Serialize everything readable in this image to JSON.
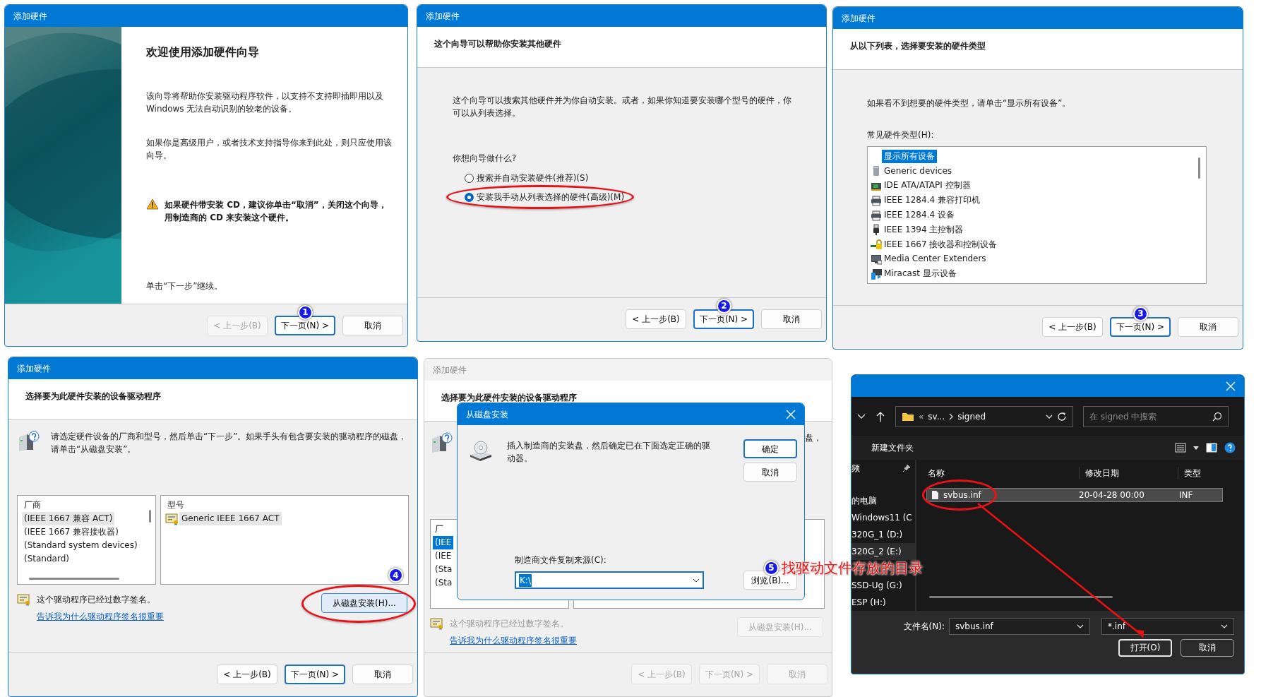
{
  "welcome_wizard": {
    "title": "添加硬件",
    "heading": "欢迎使用添加硬件向导",
    "paragraphs": [
      "该向导将帮助你安装驱动程序软件，以支持不支持即插即用以及 Windows 无法自动识别的较老的设备。",
      "如果你是高级用户，或者技术支持指导你来到此处，则只应使用该向导。"
    ],
    "warning": "如果硬件带安装 CD，建议你单击“取消”，关闭这个向导，用制造商的 CD 来安装这个硬件。",
    "footer_note": "单击“下一步”继续。",
    "buttons": [
      {
        "label": "< 上一步(B)",
        "disabled": true,
        "default": false
      },
      {
        "label": "下一页(N) >",
        "disabled": false,
        "default": true,
        "step_badge": "1"
      },
      {
        "label": "取消",
        "disabled": false,
        "default": false
      }
    ]
  },
  "task_wizard": {
    "title": "添加硬件",
    "heading": "这个向导可以帮助你安装其他硬件",
    "paragraph": "这个向导可以搜索其他硬件并为你自动安装。或者，如果你知道要安装哪个型号的硬件，你可以从列表选择。",
    "question": "你想向导做什么?",
    "options": [
      {
        "label": "搜索并自动安装硬件(推荐)(S)",
        "selected": false,
        "circled": false
      },
      {
        "label": "安装我手动从列表选择的硬件(高级)(M)",
        "selected": true,
        "circled": true
      }
    ],
    "buttons": [
      {
        "label": "< 上一步(B)",
        "disabled": false,
        "default": false
      },
      {
        "label": "下一页(N) >",
        "disabled": false,
        "default": true,
        "step_badge": "2"
      },
      {
        "label": "取消",
        "disabled": false,
        "default": false
      }
    ]
  },
  "hardware_type_wizard": {
    "title": "添加硬件",
    "heading": "从以下列表，选择要安装的硬件类型",
    "paragraph": "如果看不到想要的硬件类型，请单击“显示所有设备”。",
    "list_label": "常见硬件类型(H):",
    "items": [
      {
        "kind": "none",
        "label": "显示所有设备",
        "selected": true
      },
      {
        "kind": "tower",
        "label": "Generic devices",
        "selected": false
      },
      {
        "kind": "card",
        "label": "IDE ATA/ATAPI 控制器",
        "selected": false
      },
      {
        "kind": "printer",
        "label": "IEEE 1284.4 兼容打印机",
        "selected": false
      },
      {
        "kind": "printer",
        "label": "IEEE 1284.4 设备",
        "selected": false
      },
      {
        "kind": "plug",
        "label": "IEEE 1394 主控制器",
        "selected": false
      },
      {
        "kind": "lock",
        "label": "IEEE 1667 接收器和控制设备",
        "selected": false
      },
      {
        "kind": "monitor",
        "label": "Media Center Extenders",
        "selected": false
      },
      {
        "kind": "cast",
        "label": "Miracast 显示设备",
        "selected": false
      }
    ],
    "buttons": [
      {
        "label": "< 上一步(B)",
        "disabled": false,
        "default": false
      },
      {
        "label": "下一页(N) >",
        "disabled": false,
        "default": true,
        "step_badge": "3"
      },
      {
        "label": "取消",
        "disabled": false,
        "default": false
      }
    ]
  },
  "driver_wizard": {
    "title": "添加硬件",
    "heading": "选择要为此硬件安装的设备驱动程序",
    "description": "请选定硬件设备的厂商和型号，然后单击“下一步”。如果手头有包含要安装的驱动程序的磁盘，请单击“从磁盘安装”。",
    "lists_focused": false,
    "manufacturer_header": "厂商",
    "manufacturers": [
      {
        "label": "(IEEE 1667 兼容 ACT)",
        "selected": true
      },
      {
        "label": "(IEEE 1667 兼容接收器)",
        "selected": false
      },
      {
        "label": "(Standard system devices)",
        "selected": false
      },
      {
        "label": "(Standard)",
        "selected": false
      }
    ],
    "model_header": "型号",
    "models": [
      {
        "label": "Generic IEEE 1667 ACT",
        "selected": true
      }
    ],
    "signed_note": "这个驱动程序已经过数字签名。",
    "link": "告诉我为什么驱动程序签名很重要",
    "disk_button": {
      "label": "从磁盘安装(H)...",
      "disabled": false,
      "circled": true,
      "step_badge": "4"
    },
    "buttons": [
      {
        "label": "< 上一步(B)",
        "disabled": false,
        "default": false
      },
      {
        "label": "下一页(N) >",
        "disabled": false,
        "default": true
      },
      {
        "label": "取消",
        "disabled": false,
        "default": false
      }
    ]
  },
  "disk_install_screen": {
    "title": "添加硬件",
    "inactive": true,
    "heading": "选择要为此硬件安装的设备驱动程序",
    "description_tail": "盘，",
    "lists_focused": true,
    "manufacturer_header": "厂",
    "manufacturers": [
      {
        "label": "(IEE",
        "selected": true
      },
      {
        "label": "(IEE",
        "selected": false
      },
      {
        "label": "(Sta",
        "selected": false
      },
      {
        "label": "(Sta",
        "selected": false
      }
    ],
    "signed_note": "这个驱动程序已经过数字签名。",
    "link": "告诉我为什么驱动程序签名很重要",
    "disk_button": {
      "label": "从磁盘安装(H)...",
      "disabled": true
    },
    "buttons": [
      {
        "label": "< 上一步(B)",
        "disabled": true,
        "default": false
      },
      {
        "label": "下一页(N) >",
        "disabled": true,
        "default": false
      },
      {
        "label": "取消",
        "disabled": true,
        "default": false
      }
    ],
    "dialog": {
      "title": "从磁盘安装",
      "message": "插入制造商的安装盘，然后确定已在下面选定正确的驱动器。",
      "ok": "确定",
      "cancel": "取消",
      "source_label": "制造商文件复制来源(C):",
      "source_value": "K:\\",
      "value_selected": true,
      "browse": "浏览(B)..."
    }
  },
  "callout": {
    "step_badge": "5",
    "text": "找驱动文件存放的目录"
  },
  "file_dialog": {
    "breadcrumb_prefix": "«",
    "breadcrumb": [
      "sv...",
      "signed"
    ],
    "search_placeholder": "在 signed 中搜索",
    "new_folder": "新建文件夹",
    "nav_items": [
      {
        "label": "频",
        "pinned": true,
        "selected": false
      },
      {
        "label": "的电脑",
        "pinned": false,
        "selected": false
      },
      {
        "label": "Windows11 (C",
        "pinned": false,
        "selected": false
      },
      {
        "label": "320G_1 (D:)",
        "pinned": false,
        "selected": false
      },
      {
        "label": "320G_2 (E:)",
        "pinned": false,
        "selected": true
      },
      {
        "label": "SSD-Ug (G:)",
        "pinned": false,
        "selected": false
      },
      {
        "label": "ESP (H:)",
        "pinned": false,
        "selected": false
      }
    ],
    "columns": [
      "名称",
      "修改日期",
      "类型"
    ],
    "rows": [
      {
        "name": "svbus.inf",
        "date": "20-04-28 00:00",
        "type": "INF",
        "selected": true,
        "circled": true
      }
    ],
    "filename_label": "文件名(N):",
    "filename": "svbus.inf",
    "filter": "*.inf",
    "open_button": "打开(O)",
    "cancel_button": "取消"
  }
}
